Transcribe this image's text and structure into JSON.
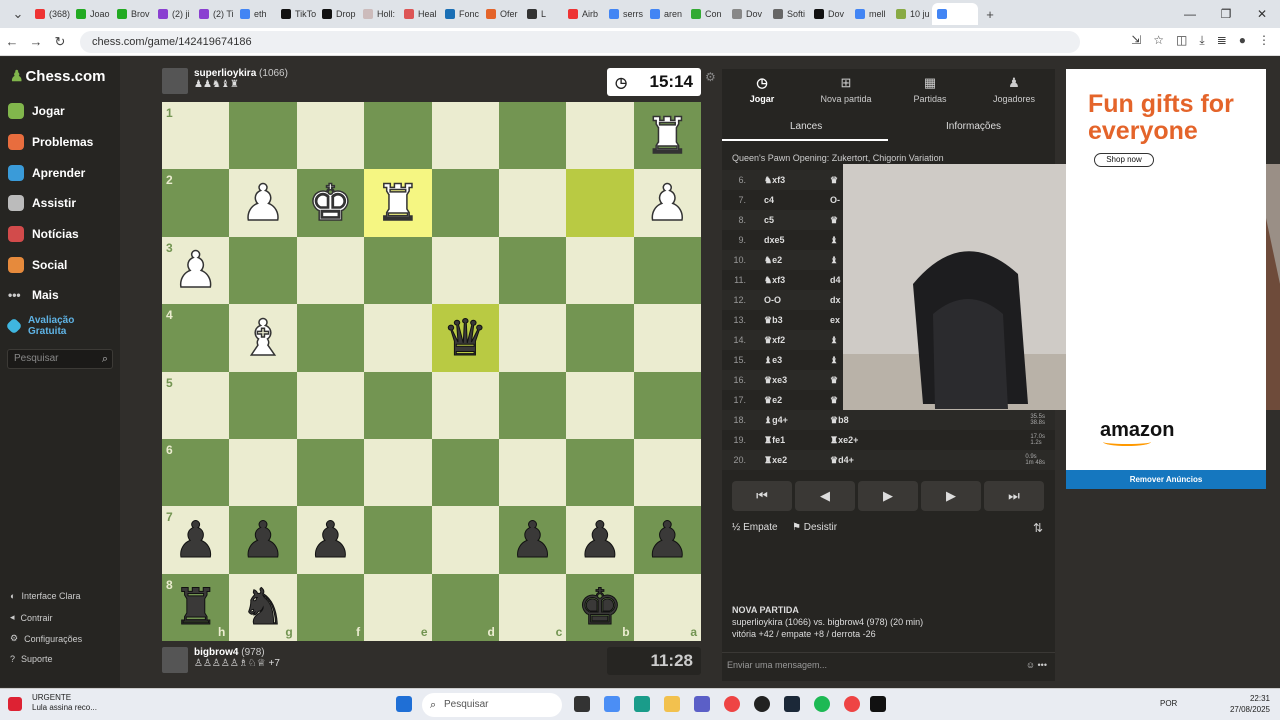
{
  "browser": {
    "tabs": [
      "(368)",
      "Joao",
      "Brov",
      "(2) ji",
      "(2) Ti",
      "eth",
      "TikTo",
      "Drop",
      "Holl:",
      "Heal",
      "Fonc",
      "Ofer",
      "L",
      "Airb",
      "serrs",
      "aren",
      "Con",
      "Dov",
      "Softi",
      "Dov",
      "mell",
      "10 ju",
      ""
    ],
    "url": "chess.com/game/142419674186"
  },
  "sidebar": {
    "logo": "Chess.com",
    "items": [
      "Jogar",
      "Problemas",
      "Aprender",
      "Assistir",
      "Notícias",
      "Social",
      "Mais"
    ],
    "free_trial": "Avaliação Gratuita",
    "search_placeholder": "Pesquisar",
    "footer": [
      "Interface Clara",
      "Contrair",
      "Configurações",
      "Suporte"
    ]
  },
  "top_player": {
    "name": "superlioykira",
    "rating": "(1066)",
    "captured": "♟♟♞♝♜",
    "clock": "15:14"
  },
  "bottom_player": {
    "name": "bigbrow4",
    "rating": "(978)",
    "captured": "♙♙♙♙♙♗♘♕ +7",
    "clock": "11:28"
  },
  "board": {
    "ranks": [
      "1",
      "2",
      "3",
      "4",
      "5",
      "6",
      "7",
      "8"
    ],
    "files": [
      "h",
      "g",
      "f",
      "e",
      "d",
      "c",
      "b",
      "a"
    ],
    "pieces": [
      [
        "",
        "",
        "",
        "",
        "",
        "",
        "",
        "♜"
      ],
      [
        "",
        "♟",
        "♚",
        "♜",
        "",
        "",
        "",
        "♟"
      ],
      [
        "♟",
        "",
        "",
        "",
        "",
        "",
        "",
        ""
      ],
      [
        "",
        "♝",
        "",
        "",
        "♛",
        "",
        "",
        ""
      ],
      [
        "",
        "",
        "",
        "",
        "",
        "",
        "",
        ""
      ],
      [
        "",
        "",
        "",
        "",
        "",
        "",
        "",
        ""
      ],
      [
        "♟",
        "♟",
        "♟",
        "",
        "",
        "♟",
        "♟",
        "♟"
      ],
      [
        "♜",
        "♞",
        "",
        "",
        "",
        "",
        "♚",
        ""
      ]
    ],
    "colors": [
      [
        "",
        "",
        "",
        "",
        "",
        "",
        "",
        "w"
      ],
      [
        "",
        "w",
        "w",
        "w",
        "",
        "",
        "",
        "w"
      ],
      [
        "w",
        "",
        "",
        "",
        "",
        "",
        "",
        ""
      ],
      [
        "",
        "w",
        "",
        "",
        "b",
        "",
        "",
        ""
      ],
      [
        "",
        "",
        "",
        "",
        "",
        "",
        "",
        ""
      ],
      [
        "",
        "",
        "",
        "",
        "",
        "",
        "",
        ""
      ],
      [
        "b",
        "b",
        "b",
        "",
        "",
        "b",
        "b",
        "b"
      ],
      [
        "b",
        "b",
        "",
        "",
        "",
        "",
        "b",
        ""
      ]
    ],
    "highlights": [
      [
        1,
        3
      ],
      [
        1,
        6
      ],
      [
        3,
        4
      ]
    ]
  },
  "panel": {
    "tabs": [
      "Jogar",
      "Nova partida",
      "Partidas",
      "Jogadores"
    ],
    "subtabs": [
      "Lances",
      "Informações"
    ],
    "opening": "Queen's Pawn Opening: Zukertort, Chigorin Variation",
    "moves": [
      {
        "n": "6.",
        "w": "♞xf3",
        "b": "♛"
      },
      {
        "n": "7.",
        "w": "c4",
        "b": "O-"
      },
      {
        "n": "8.",
        "w": "c5",
        "b": "♛"
      },
      {
        "n": "9.",
        "w": "dxe5",
        "b": "♝"
      },
      {
        "n": "10.",
        "w": "♞e2",
        "b": "♝"
      },
      {
        "n": "11.",
        "w": "♞xf3",
        "b": "d4"
      },
      {
        "n": "12.",
        "w": "O-O",
        "b": "dx"
      },
      {
        "n": "13.",
        "w": "♛b3",
        "b": "ex"
      },
      {
        "n": "14.",
        "w": "♛xf2",
        "b": "♝"
      },
      {
        "n": "15.",
        "w": "♝e3",
        "b": "♝"
      },
      {
        "n": "16.",
        "w": "♛xe3",
        "b": "♛"
      },
      {
        "n": "17.",
        "w": "♛e2",
        "b": "♛"
      },
      {
        "n": "18.",
        "w": "♝g4+",
        "b": "♛b8"
      },
      {
        "n": "19.",
        "w": "♜fe1",
        "b": "♜xe2+"
      },
      {
        "n": "20.",
        "w": "♜xe2",
        "b": "♛d4+"
      }
    ],
    "times": [
      [
        "35.5s",
        "38.8s"
      ],
      [
        "17.0s",
        "1.2s"
      ],
      [
        "0.9s",
        "1m 48s"
      ]
    ],
    "controls": [
      "⏮",
      "◀",
      "▶",
      "▶",
      "⏭"
    ],
    "draw": "Empate",
    "resign": "Desistir",
    "new_game_title": "NOVA PARTIDA",
    "new_game_players": "superlioykira (1066) vs. bigbrow4 (978) (20 min)",
    "new_game_stats": "vitória +42 / empate +8 / derrota -26",
    "chat_placeholder": "Enviar uma mensagem..."
  },
  "ad": {
    "headline": "Fun gifts for everyone",
    "shop": "Shop now",
    "brand": "amazon",
    "remove": "Remover Anúncios"
  },
  "taskbar": {
    "weather_title": "URGENTE",
    "weather_sub": "Lula assina reco...",
    "search_placeholder": "Pesquisar",
    "lang": "POR",
    "time": "22:31",
    "date": "27/08/2025"
  }
}
